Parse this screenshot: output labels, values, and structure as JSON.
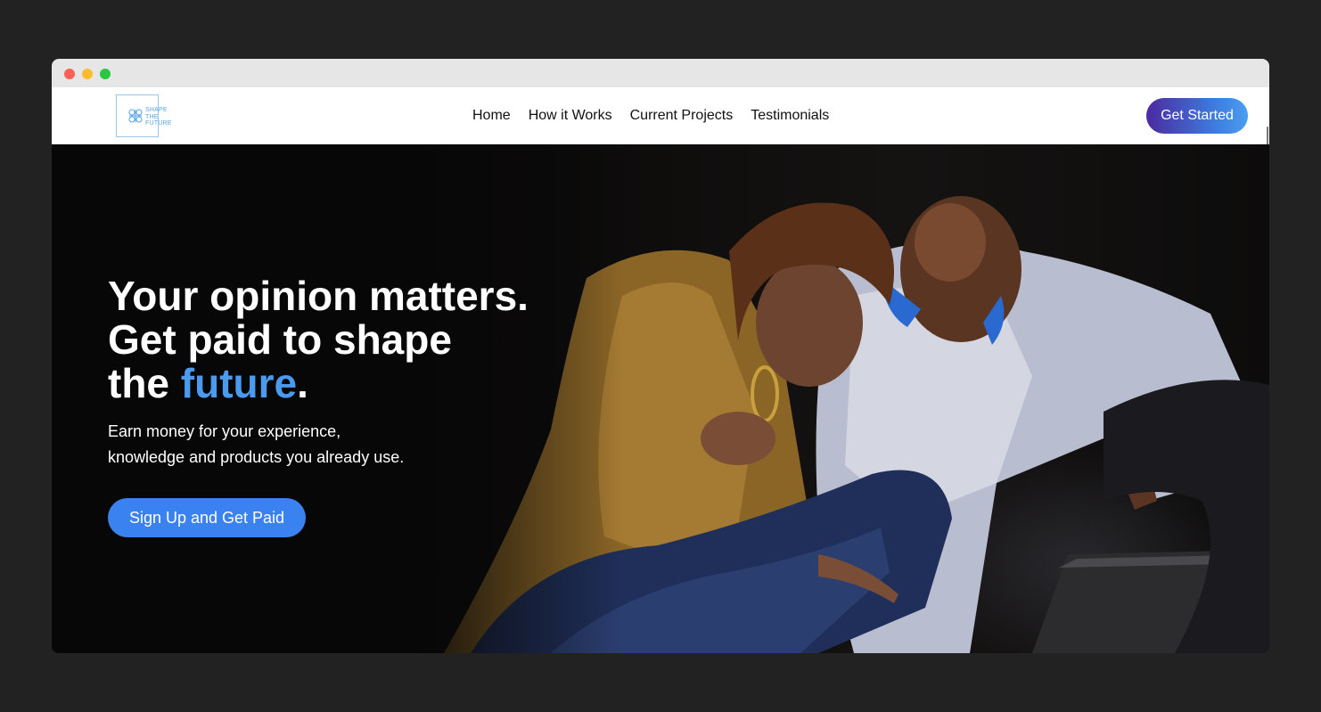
{
  "window": {
    "controls": [
      "close",
      "minimize",
      "maximize"
    ]
  },
  "brand": {
    "logo_icon": "knot-icon",
    "logo_lines": [
      "SHAPE",
      "THE",
      "FUTURE"
    ]
  },
  "nav": {
    "items": [
      {
        "label": "Home"
      },
      {
        "label": "How it Works"
      },
      {
        "label": "Current Projects"
      },
      {
        "label": "Testimonials"
      }
    ],
    "cta_label": "Get Started"
  },
  "hero": {
    "headline": {
      "line1": "Your opinion matters.",
      "line2": "Get paid to shape",
      "line3_prefix": "the ",
      "line3_accent": "future",
      "line3_suffix": "."
    },
    "subtext_lines": [
      "Earn money for your experience,",
      "knowledge and products you already use."
    ],
    "cta_label": "Sign Up and Get Paid",
    "image_subject": "photo-of-two-people-smiling-at-laptop"
  },
  "colors": {
    "accent_blue": "#4a9af0",
    "button_blue": "#3a82f0",
    "gradient_start": "#4b2aa0",
    "gradient_end": "#4a9ef0",
    "hero_background": "#0b0a0a"
  }
}
